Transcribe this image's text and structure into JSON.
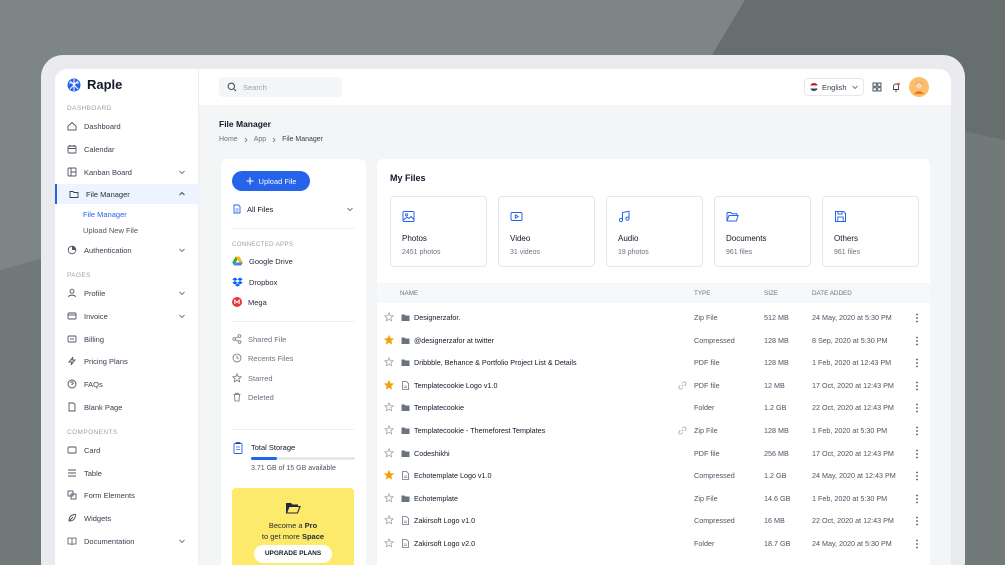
{
  "colors": {
    "accent": "#2563eb",
    "star": "#f59e0b",
    "promo": "#fde96a"
  },
  "brand": {
    "name": "Raple"
  },
  "sidebar": {
    "sections": [
      "Dashboard",
      "Pages",
      "Components"
    ],
    "items": [
      {
        "label": "Dashboard",
        "icon": "home-icon"
      },
      {
        "label": "Calendar",
        "icon": "calendar-icon"
      },
      {
        "label": "Kanban Board",
        "icon": "kanban-icon"
      },
      {
        "label": "File Manager",
        "icon": "folder-icon"
      },
      {
        "label": "Authentication",
        "icon": "auth-icon"
      },
      {
        "label": "Profile",
        "icon": "user-icon"
      },
      {
        "label": "Invoice",
        "icon": "invoice-icon"
      },
      {
        "label": "Billing",
        "icon": "billing-icon"
      },
      {
        "label": "Pricing Plans",
        "icon": "bolt-icon"
      },
      {
        "label": "FAQs",
        "icon": "help-icon"
      },
      {
        "label": "Blank Page",
        "icon": "page-icon"
      },
      {
        "label": "Card",
        "icon": "card-icon"
      },
      {
        "label": "Table",
        "icon": "table-icon"
      },
      {
        "label": "Form Elements",
        "icon": "form-icon"
      },
      {
        "label": "Widgets",
        "icon": "widget-icon"
      },
      {
        "label": "Documentation",
        "icon": "book-icon"
      }
    ],
    "subitems": [
      "File Manager",
      "Upload New File"
    ]
  },
  "topbar": {
    "search_placeholder": "Search",
    "language": "English"
  },
  "page": {
    "title": "File Manager",
    "breadcrumb": [
      "Home",
      "App",
      "File Manager"
    ]
  },
  "left_panel": {
    "upload_label": "Upload File",
    "filter_label": "All Files",
    "connected_label": "Connected Apps",
    "apps": [
      "Google Drive",
      "Dropbox",
      "Mega"
    ],
    "links": [
      "Shared File",
      "Recents Files",
      "Starred",
      "Deleted"
    ],
    "storage_title": "Total Storage",
    "storage_text": "3.71 GB of 15 GB available",
    "storage_used": 0.247,
    "promo_line1_pre": "Become a ",
    "promo_line1_bold": "Pro",
    "promo_line2_pre": "to get more ",
    "promo_line2_bold": "Space",
    "promo_button": "UPGRADE PLANS"
  },
  "files_section": {
    "title": "My Files",
    "categories": [
      {
        "name": "Photos",
        "count": "2451 photos",
        "icon": "image-icon"
      },
      {
        "name": "Video",
        "count": "31 videos",
        "icon": "video-icon"
      },
      {
        "name": "Audio",
        "count": "19 photos",
        "icon": "music-icon"
      },
      {
        "name": "Documents",
        "count": "961 files",
        "icon": "folder-open-icon"
      },
      {
        "name": "Others",
        "count": "961 files",
        "icon": "save-icon"
      }
    ],
    "columns": [
      "Name",
      "Type",
      "Size",
      "Date Added"
    ],
    "rows": [
      {
        "name": "Designerzafor.",
        "type": "Zip File",
        "size": "512 MB",
        "date": "24 May, 2020 at 5:30 PM",
        "starred": false,
        "kind": "folder",
        "linked": false
      },
      {
        "name": "@designerzafor at twitter",
        "type": "Compressed",
        "size": "128 MB",
        "date": "8 Sep, 2020 at 5:30 PM",
        "starred": true,
        "kind": "folder",
        "linked": false
      },
      {
        "name": "Dribbble, Behance & Portfolio Project List & Details",
        "type": "PDF file",
        "size": "128 MB",
        "date": "1 Feb, 2020 at 12:43 PM",
        "starred": false,
        "kind": "folder",
        "linked": false
      },
      {
        "name": "Templatecookie Logo v1.0",
        "type": "PDF file",
        "size": "12 MB",
        "date": "17 Oct, 2020  at 12:43 PM",
        "starred": true,
        "kind": "file",
        "linked": true
      },
      {
        "name": "Templatecookie",
        "type": "Folder",
        "size": "1.2 GB",
        "date": "22 Oct, 2020 at 12:43 PM",
        "starred": false,
        "kind": "folder",
        "linked": false
      },
      {
        "name": "Templatecookie - Themeforest Templates",
        "type": "Zip File",
        "size": "128 MB",
        "date": "1 Feb, 2020 at 5:30 PM",
        "starred": false,
        "kind": "folder",
        "linked": true
      },
      {
        "name": "Codeshikhi",
        "type": "PDF file",
        "size": "256 MB",
        "date": "17 Oct, 2020 at 12:43 PM",
        "starred": false,
        "kind": "folder",
        "linked": false
      },
      {
        "name": "Echotemplate Logo v1.0",
        "type": "Compressed",
        "size": "1.2 GB",
        "date": "24 May, 2020 at 12:43 PM",
        "starred": true,
        "kind": "file",
        "linked": false
      },
      {
        "name": "Echotemplate",
        "type": "Zip File",
        "size": "14.6 GB",
        "date": "1 Feb, 2020 at 5:30 PM",
        "starred": false,
        "kind": "folder",
        "linked": false
      },
      {
        "name": "Zakirsoft Logo v1.0",
        "type": "Compressed",
        "size": "16 MB",
        "date": "22 Oct, 2020 at 12:43 PM",
        "starred": false,
        "kind": "file",
        "linked": false
      },
      {
        "name": "Zakirsoft Logo v2.0",
        "type": "Folder",
        "size": "18.7 GB",
        "date": "24 May, 2020 at 5:30 PM",
        "starred": false,
        "kind": "file",
        "linked": false
      }
    ]
  }
}
